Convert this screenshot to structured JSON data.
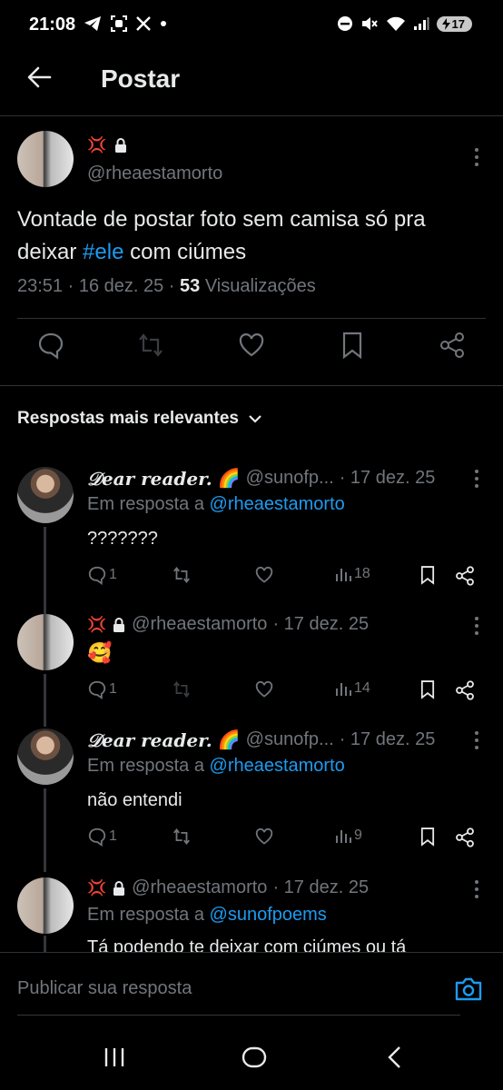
{
  "status_bar": {
    "time": "21:08",
    "battery": "17"
  },
  "header": {
    "title": "Postar"
  },
  "post": {
    "author_emojis": "💢",
    "handle": "@rheaestamorto",
    "text_pre": "Vontade de postar foto sem camisa só pra deixar ",
    "hashtag": "#ele",
    "text_post": " com ciúmes",
    "time": "23:51 · 16 dez. 25 · ",
    "views_count": "53",
    "views_label": " Visualizações"
  },
  "sort": {
    "label": "Respostas mais relevantes"
  },
  "replies": [
    {
      "name": "𝒟ear reader.",
      "emoji": "🌈",
      "handle": "@sunofp...",
      "date": "· 17 dez. 25",
      "in_reply_label": "Em resposta a ",
      "in_reply_handle": "@rheaestamorto",
      "text": "???????",
      "replies": "1",
      "views": "18"
    },
    {
      "name": "💢",
      "handle": "@rheaestamorto",
      "date": "· 17 dez. 25",
      "text": "🥰",
      "replies": "1",
      "views": "14"
    },
    {
      "name": "𝒟ear reader.",
      "emoji": "🌈",
      "handle": "@sunofp...",
      "date": "· 17 dez. 25",
      "in_reply_label": "Em resposta a ",
      "in_reply_handle": "@rheaestamorto",
      "text": "não entendi",
      "replies": "1",
      "views": "9"
    },
    {
      "name": "💢",
      "handle": "@rheaestamorto",
      "date": "· 17 dez. 25",
      "in_reply_label": "Em resposta a ",
      "in_reply_handle": "@sunofpoems",
      "text": "Tá podendo te deixar com ciúmes ou tá"
    }
  ],
  "composer": {
    "placeholder": "Publicar sua resposta"
  },
  "colors": {
    "accent": "#1d9bf0",
    "muted": "#71767b",
    "text": "#e7e9ea",
    "background": "#000000"
  }
}
